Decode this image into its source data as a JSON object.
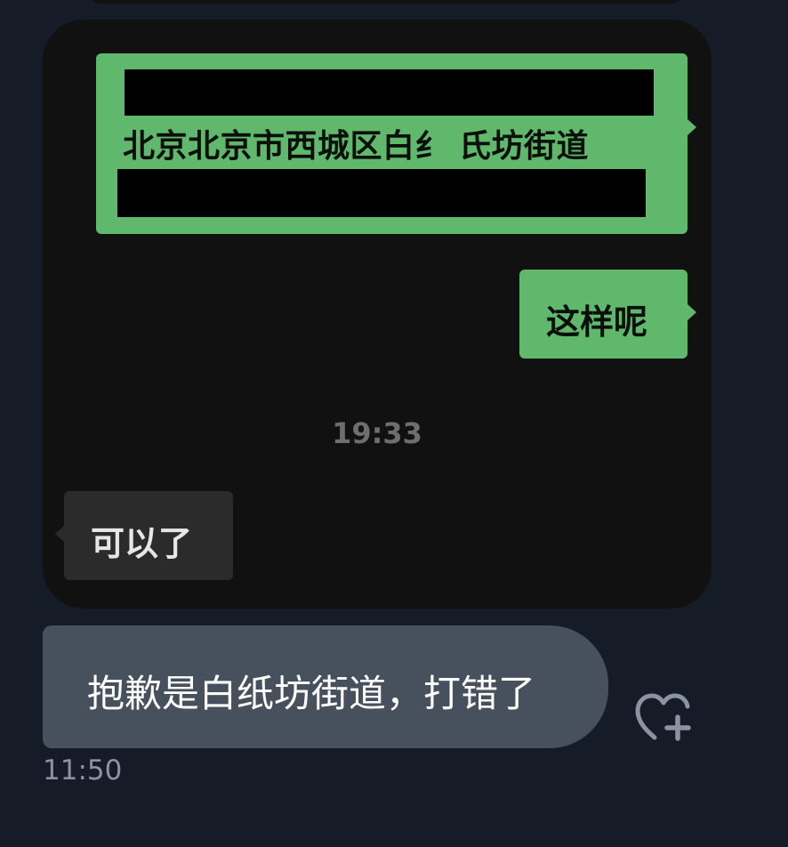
{
  "shared_screenshot": {
    "address_message": "北京北京市西城区白纟 氏坊街道",
    "reply_message": "这样呢",
    "timestamp": "19:33",
    "incoming_message": "可以了"
  },
  "conversation": {
    "message_text": "抱歉是白纸坊街道，打错了",
    "message_time": "11:50",
    "react_icon": "heart-plus-icon"
  },
  "colors": {
    "background": "#161c27",
    "shared_card": "#111111",
    "green_bubble": "#5fb86b",
    "gray_bubble": "#2b2b2b",
    "my_bubble": "#47505d"
  }
}
